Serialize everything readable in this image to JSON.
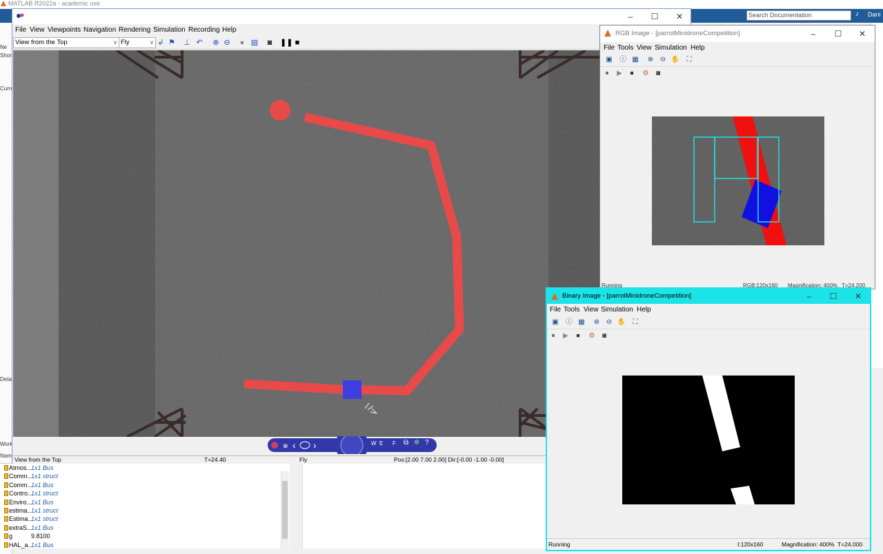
{
  "matlab": {
    "title": "MATLAB R2022a - academic use",
    "search_placeholder": "Search Documentation",
    "user": "Dani",
    "side_labels": [
      "Ne",
      "Shor",
      "Curre",
      "Detai",
      "Work",
      "Name"
    ]
  },
  "workspace": {
    "rows": [
      {
        "name": "Atmos...",
        "value": "1x1 Bus"
      },
      {
        "name": "Comm...",
        "value": "1x1 struct"
      },
      {
        "name": "Comm...",
        "value": "1x1 Bus"
      },
      {
        "name": "Contro...",
        "value": "1x1 struct"
      },
      {
        "name": "Enviro...",
        "value": "1x1 Bus"
      },
      {
        "name": "estima...",
        "value": "1x1 struct"
      },
      {
        "name": "Estima...",
        "value": "1x1 struct"
      },
      {
        "name": "extraS...",
        "value": "1x1 Bus"
      },
      {
        "name": "g",
        "value": "9.8100"
      },
      {
        "name": "HAL_a...",
        "value": "1x1 Bus"
      }
    ]
  },
  "vr": {
    "menu": [
      "File",
      "View",
      "Viewpoints",
      "Navigation",
      "Rendering",
      "Simulation",
      "Recording",
      "Help"
    ],
    "viewpoint": "View from the Top",
    "nav_mode": "Fly",
    "nav_letters": [
      "W",
      "E",
      "F"
    ],
    "status": {
      "viewpoint": "View from the Top",
      "time": "T=24.40",
      "mode": "Fly",
      "pos": "Pos:[2.00 7.00 2.00] Dir:[-0.00 -1.00 -0.00]"
    }
  },
  "rgb_window": {
    "title": "RGB Image - [parrotMinidroneCompetition]",
    "menu": [
      "File",
      "Tools",
      "View",
      "Simulation",
      "Help"
    ],
    "status": {
      "left": "Running",
      "size": "RGB:120x160",
      "mag": "Magnification: 400%",
      "time": "T=24.200"
    }
  },
  "binary_window": {
    "title": "Binary Image - [parrotMinidroneCompetition]",
    "menu": [
      "File",
      "Tools",
      "View",
      "Simulation",
      "Help"
    ],
    "status": {
      "left": "Running",
      "size": "I:120x160",
      "mag": "Magnification: 400%",
      "time": "T=24.000"
    }
  },
  "colors": {
    "track": "#e84a4a",
    "drone": "#3d3de0",
    "accent_cyan": "#1ce3e8"
  }
}
